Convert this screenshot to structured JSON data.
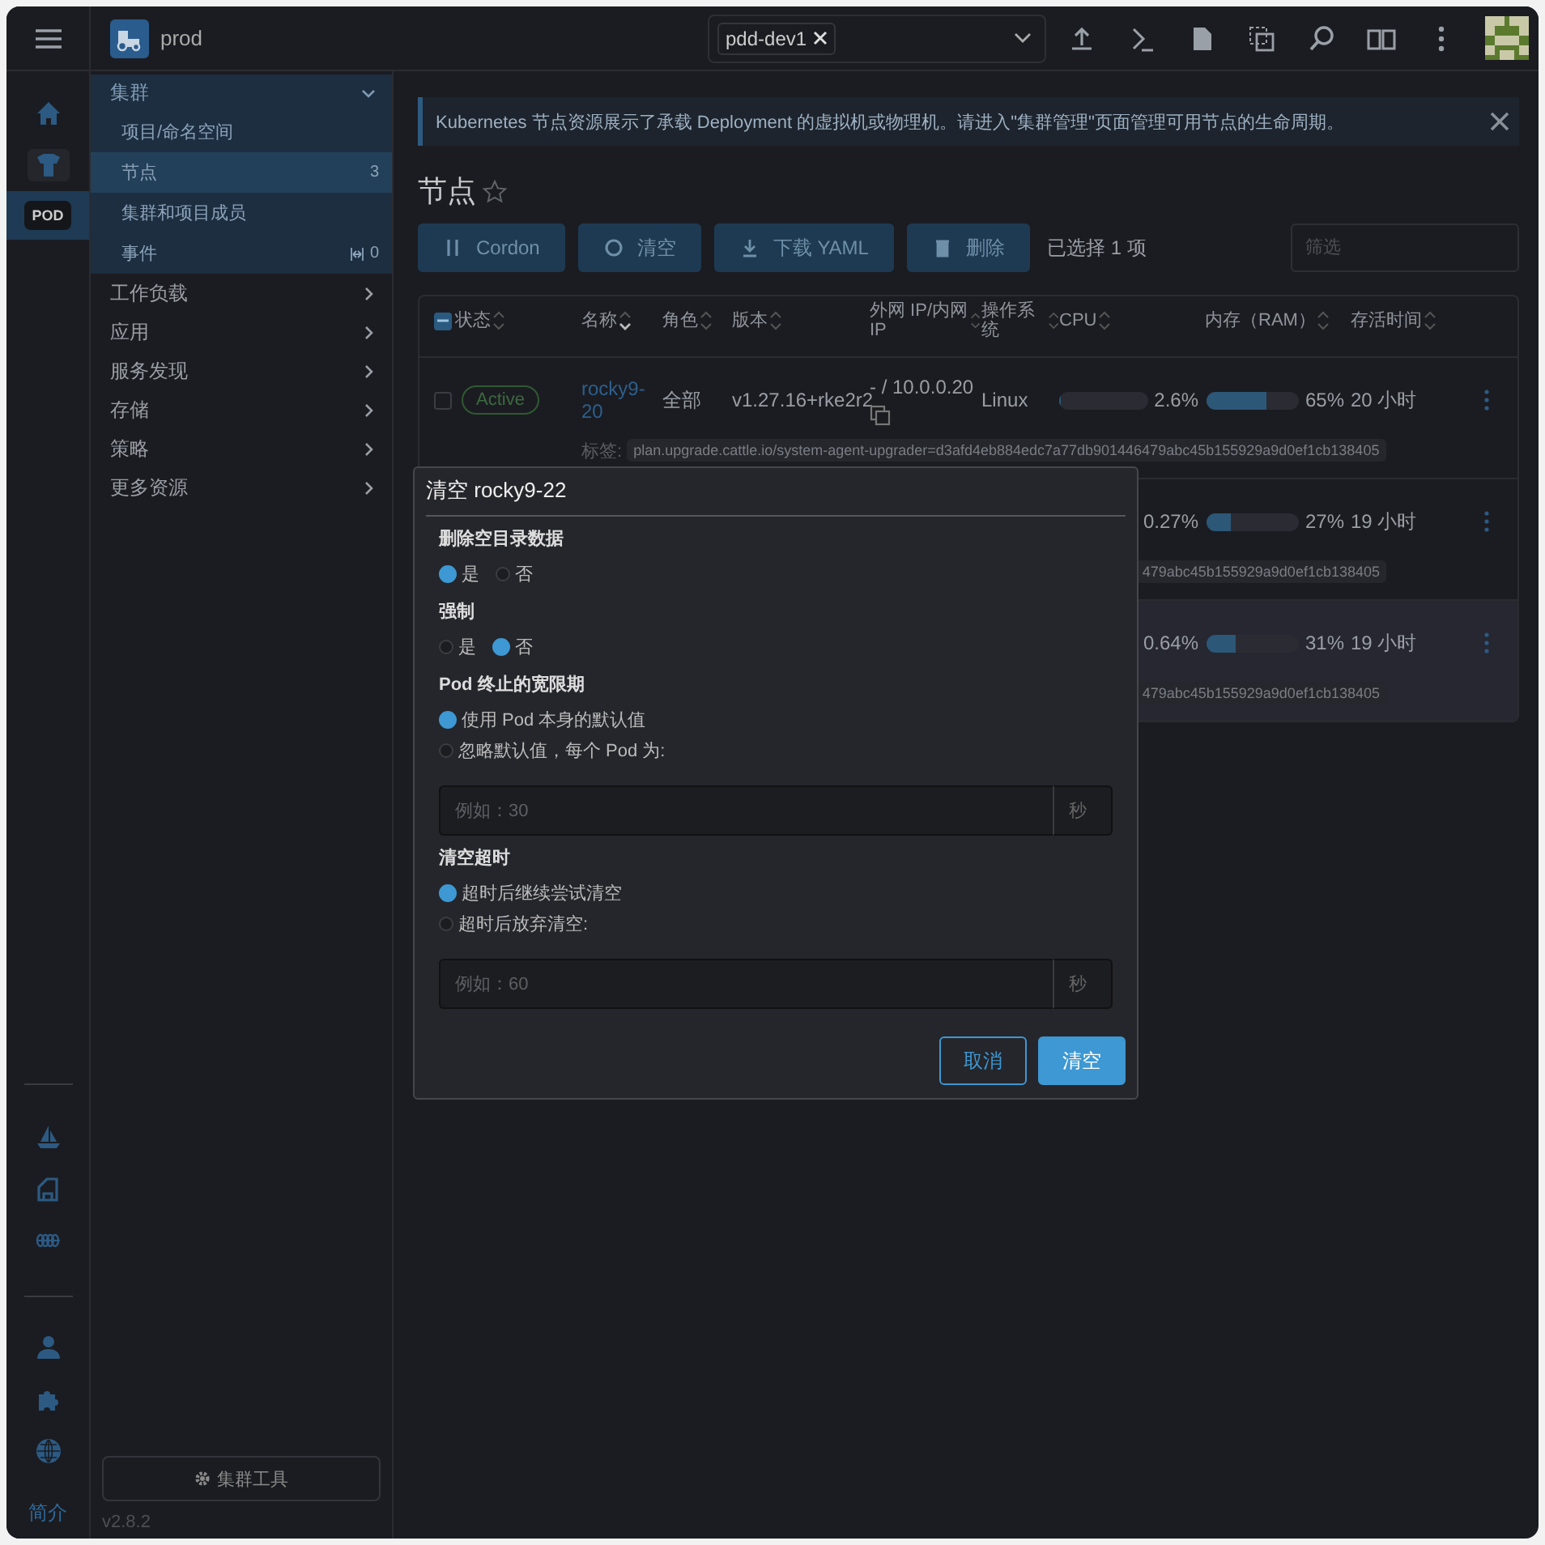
{
  "header": {
    "cluster_name": "prod",
    "cluster_filter": {
      "chips": [
        {
          "label": "pdd-dev1"
        }
      ]
    }
  },
  "rail": {
    "pod_badge": {
      "label": "POD",
      "selected": true
    },
    "footer_link": "简介"
  },
  "sidebar": {
    "groups": [
      {
        "label": "集群",
        "expanded": true,
        "children": [
          {
            "label": "项目/命名空间",
            "kind": "plain",
            "selected": false
          },
          {
            "label": "节点",
            "kind": "count",
            "count": "3",
            "selected": true
          },
          {
            "label": "集群和项目成员",
            "kind": "plain",
            "selected": false
          },
          {
            "label": "事件",
            "kind": "events",
            "count": "0",
            "selected": false
          }
        ]
      },
      {
        "label": "工作负载",
        "expanded": false
      },
      {
        "label": "应用",
        "expanded": false
      },
      {
        "label": "服务发现",
        "expanded": false
      },
      {
        "label": "存储",
        "expanded": false
      },
      {
        "label": "策略",
        "expanded": false
      },
      {
        "label": "更多资源",
        "expanded": false
      }
    ],
    "tools_button": "集群工具",
    "version": "v2.8.2"
  },
  "page": {
    "banner": "Kubernetes 节点资源展示了承载 Deployment 的虚拟机或物理机。请进入\"集群管理\"页面管理可用节点的生命周期。",
    "title": "节点",
    "starred": false,
    "actions": [
      {
        "label": "Cordon",
        "kind": "cordon"
      },
      {
        "label": "清空",
        "kind": "drain"
      },
      {
        "label": "下载 YAML",
        "kind": "download"
      },
      {
        "label": "删除",
        "kind": "delete"
      }
    ],
    "selection_text": "已选择 1 项",
    "filter": {
      "placeholder": "筛选"
    },
    "table": {
      "select_all": {
        "checked": true,
        "partial": true
      },
      "columns": [
        {
          "label": "状态",
          "sorted": false
        },
        {
          "label": "名称",
          "sorted": true
        },
        {
          "label": "角色",
          "sorted": false
        },
        {
          "label": "版本",
          "sorted": false
        },
        {
          "label": "外网 IP/内网 IP",
          "sorted": false
        },
        {
          "label": "操作系统",
          "sorted": false
        },
        {
          "label": "CPU",
          "sorted": false
        },
        {
          "label": "内存（RAM）",
          "sorted": false
        },
        {
          "label": "存活时间",
          "sorted": false
        }
      ],
      "rows": [
        {
          "selected": false,
          "status": "Active",
          "name": "rocky9-20",
          "role": "全部",
          "version": "v1.27.16+rke2r2",
          "ip": "- / 10.0.0.20",
          "os": "Linux",
          "cpu": {
            "level": 0.026,
            "reading": "2.6%"
          },
          "memory": {
            "level": 0.65,
            "reading": "65%"
          },
          "age": "20 小时",
          "label_key": "标签:",
          "label": "plan.upgrade.cattle.io/system-agent-upgrader=d3afd4eb884edc7a77db901446479abc45b155929a9d0ef1cb138405"
        },
        {
          "selected": false,
          "cpu": {
            "reading": "0.27%"
          },
          "memory": {
            "level": 0.27,
            "reading": "27%"
          },
          "age": "19 小时",
          "label": "479abc45b155929a9d0ef1cb138405"
        },
        {
          "selected": true,
          "cpu": {
            "reading": "0.64%"
          },
          "memory": {
            "level": 0.31,
            "reading": "31%"
          },
          "age": "19 小时",
          "label": "479abc45b155929a9d0ef1cb138405"
        }
      ]
    }
  },
  "dialog": {
    "title": "清空 rocky9-22",
    "sections": [
      {
        "title": "删除空目录数据",
        "kind": "inline_radios",
        "options": [
          {
            "label": "是",
            "selected": true
          },
          {
            "label": "否",
            "selected": false
          }
        ]
      },
      {
        "title": "强制",
        "kind": "inline_radios",
        "options": [
          {
            "label": "是",
            "selected": false
          },
          {
            "label": "否",
            "selected": true
          }
        ]
      },
      {
        "title": "Pod 终止的宽限期",
        "kind": "stacked_radios",
        "options": [
          {
            "label": "使用 Pod 本身的默认值",
            "selected": true
          },
          {
            "label": "忽略默认值，每个 Pod 为:",
            "selected": false
          }
        ],
        "input": {
          "placeholder": "例如：30",
          "suffix": "秒"
        }
      },
      {
        "title": "清空超时",
        "kind": "stacked_radios",
        "options": [
          {
            "label": "超时后继续尝试清空",
            "selected": true
          },
          {
            "label": "超时后放弃清空:",
            "selected": false
          }
        ],
        "input": {
          "placeholder": "例如：60",
          "suffix": "秒"
        }
      }
    ],
    "buttons": [
      {
        "label": "取消",
        "kind": "secondary"
      },
      {
        "label": "清空",
        "kind": "primary"
      }
    ]
  }
}
